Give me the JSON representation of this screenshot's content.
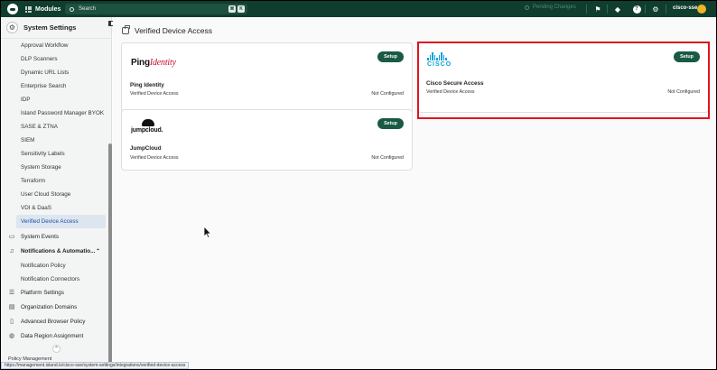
{
  "topbar": {
    "modules_label": "Modules",
    "search_placeholder": "Search",
    "shortcut_keys": [
      "⌘",
      "K"
    ],
    "pending_changes": "Pending Changes",
    "user_name": "cisco-sse",
    "icons": [
      "flag-icon",
      "school-icon",
      "help-icon",
      "gear-icon"
    ]
  },
  "sidebar": {
    "section_title": "System Settings",
    "items": [
      "Approval Workflow",
      "DLP Scanners",
      "Dynamic URL Lists",
      "Enterprise Search",
      "IDP",
      "Island Password Manager BYOK",
      "SASE & ZTNA",
      "SIEM",
      "Sensitivity Labels",
      "System Storage",
      "Terraform",
      "User Cloud Storage",
      "VDI & DaaS",
      "Verified Device Access"
    ],
    "active_item": "Verified Device Access",
    "groups": {
      "system_events": "System Events",
      "notifications": "Notifications & Automatio...",
      "notification_policy": "Notification Policy",
      "notification_connectors": "Notification Connectors",
      "platform_settings": "Platform Settings",
      "organization_domains": "Organization Domains",
      "advanced_browser_policy": "Advanced Browser Policy",
      "data_region_assignment": "Data Region Assignment"
    },
    "footer": "Policy Management",
    "status_url": "https://management.island.io/cisco-sse/system-settings/integrations/verified-device-access"
  },
  "main": {
    "title": "Verified Device Access",
    "cards": [
      {
        "logo_main": "Ping",
        "logo_accent": "Identity",
        "name": "Ping Identity",
        "type": "Verified Device Access",
        "status": "Not Configured",
        "button": "Setup"
      },
      {
        "logo_text": "CISCO",
        "name": "Cisco Secure Access",
        "type": "Verified Device Access",
        "status": "Not Configured",
        "button": "Setup"
      },
      {
        "logo_text": "jumpcloud.",
        "name": "JumpCloud",
        "type": "Verified Device Access",
        "status": "Not Configured",
        "button": "Setup"
      }
    ]
  },
  "colors": {
    "topbar": "#0f3d2e",
    "button": "#1a5a44",
    "highlight": "#e0141e",
    "active_nav": "#1e4fae",
    "cisco_blue": "#049fd9"
  }
}
